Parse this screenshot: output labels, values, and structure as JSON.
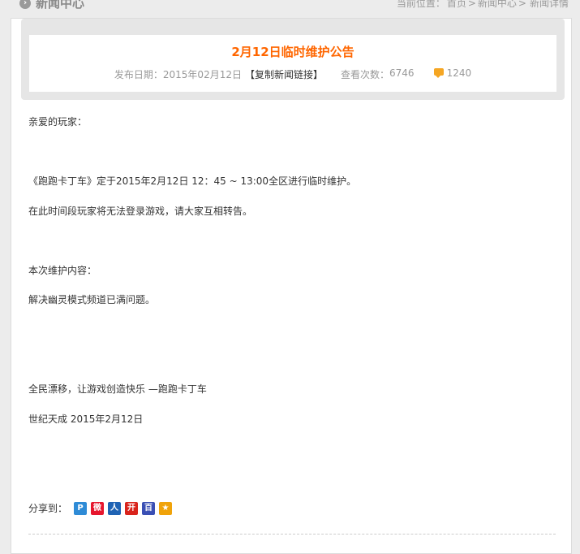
{
  "topbar": {
    "section_title": "新闻中心",
    "breadcrumb_prefix": "当前位置：",
    "breadcrumb": [
      "首页",
      "新闻中心",
      "新闻详情"
    ],
    "separator": ">"
  },
  "article": {
    "title": "2月12日临时维护公告",
    "date_label": "发布日期：",
    "date": "2015年02月12日",
    "copy_link": "【复制新闻链接】",
    "views_label": "查看次数：",
    "views": "6746",
    "comments": "1240"
  },
  "content": {
    "greeting": "亲爱的玩家：",
    "line1": "《跑跑卡丁车》定于2015年2月12日 12：45 ~ 13:00全区进行临时维护。",
    "line2": "在此时间段玩家将无法登录游戏，请大家互相转告。",
    "line3": "本次维护内容：",
    "line4": "解决幽灵模式频道已满问题。",
    "slogan": "全民漂移，让游戏创造快乐 —跑跑卡丁车",
    "signature": "世纪天成 2015年2月12日"
  },
  "share": {
    "label": "分享到：",
    "buttons": [
      {
        "icon": "qzone-icon",
        "glyph": "P",
        "color": "#2e8bd6"
      },
      {
        "icon": "weibo-icon",
        "glyph": "微",
        "color": "#e6162d"
      },
      {
        "icon": "renren-icon",
        "glyph": "人",
        "color": "#1f63b4"
      },
      {
        "icon": "kaixin-icon",
        "glyph": "开",
        "color": "#d9241c"
      },
      {
        "icon": "baidu-icon",
        "glyph": "百",
        "color": "#3a4fb4"
      },
      {
        "icon": "favorite-icon",
        "glyph": "★",
        "color": "#f0a30a"
      }
    ]
  }
}
